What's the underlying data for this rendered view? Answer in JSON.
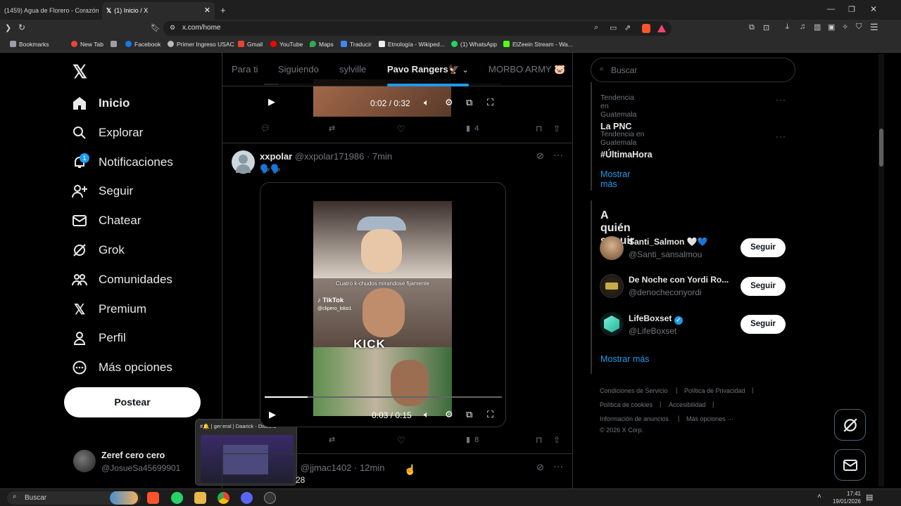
{
  "browser": {
    "tabs": [
      {
        "title": "(1459) Agua de Florero - Corazón Pa"
      },
      {
        "title": "(1) Inicio / X"
      }
    ],
    "url": "x.com/home",
    "bookmarks": [
      "Bookmarks",
      "New Tab",
      "Facebook",
      "Primer Ingreso USAC",
      "Gmail",
      "YouTube",
      "Maps",
      "Traducir",
      "Etnología - Wikiped...",
      "(1) WhatsApp",
      "ElZeein Stream - Wa..."
    ]
  },
  "sidebar": {
    "items": [
      {
        "label": "Inicio"
      },
      {
        "label": "Explorar"
      },
      {
        "label": "Notificaciones",
        "badge": "1"
      },
      {
        "label": "Seguir"
      },
      {
        "label": "Chatear"
      },
      {
        "label": "Grok"
      },
      {
        "label": "Comunidades"
      },
      {
        "label": "Premium"
      },
      {
        "label": "Perfil"
      },
      {
        "label": "Más opciones"
      }
    ],
    "post_label": "Postear",
    "account": {
      "name": "Zeref cero cero",
      "handle": "@JosueSa45699901"
    }
  },
  "feed": {
    "tabs": [
      "Para ti",
      "Siguiendo",
      "sylville",
      "Pavo Rangers🦅",
      "MORBO ARMY 🐷"
    ],
    "post1": {
      "time": "0:02 / 0:32",
      "views": "4"
    },
    "post2": {
      "name": "xxpolar",
      "handle": "@xxpolar171986",
      "time": "7min",
      "text": "🗣️🗣️",
      "video_time": "0:03 / 0:15",
      "overlay_caption": "Cuatro k-chudos mirandose fijamente",
      "tiktok": "TikTok",
      "tiktok_user": "@clipero_loko1",
      "kick": "KICK",
      "views": "8"
    },
    "post3": {
      "handle": "@jjmac1402",
      "time": "12min",
      "text": "28"
    }
  },
  "right": {
    "search_placeholder": "Buscar",
    "trends": [
      {
        "context": "Tendencia en Guatemala",
        "name": "La PNC"
      },
      {
        "context": "Tendencia en Guatemala",
        "name": "#ÚltimaHora"
      }
    ],
    "show_more": "Mostrar más",
    "who_to_follow_title": "A quién seguir",
    "follow": [
      {
        "name": "Santi_Salmon 🤍💙",
        "handle": "@Santi_sansalmou",
        "button": "Seguir"
      },
      {
        "name": "De Noche con Yordi Ro...",
        "handle": "@denocheconyordi",
        "button": "Seguir"
      },
      {
        "name": "LifeBoxset",
        "handle": "@LifeBoxset",
        "button": "Seguir"
      }
    ],
    "show_more2": "Mostrar más",
    "footer": [
      "Condiciones de Servicio",
      "Política de Privacidad",
      "Política de cookies",
      "Accesibilidad",
      "Información de anuncios",
      "Más opciones ···",
      "© 2026 X Corp."
    ]
  },
  "discord_preview": {
    "title": "#🔔 | general | Daarick - Discord"
  },
  "taskbar": {
    "search": "Buscar",
    "time": "17:41",
    "date": "19/01/2026"
  }
}
